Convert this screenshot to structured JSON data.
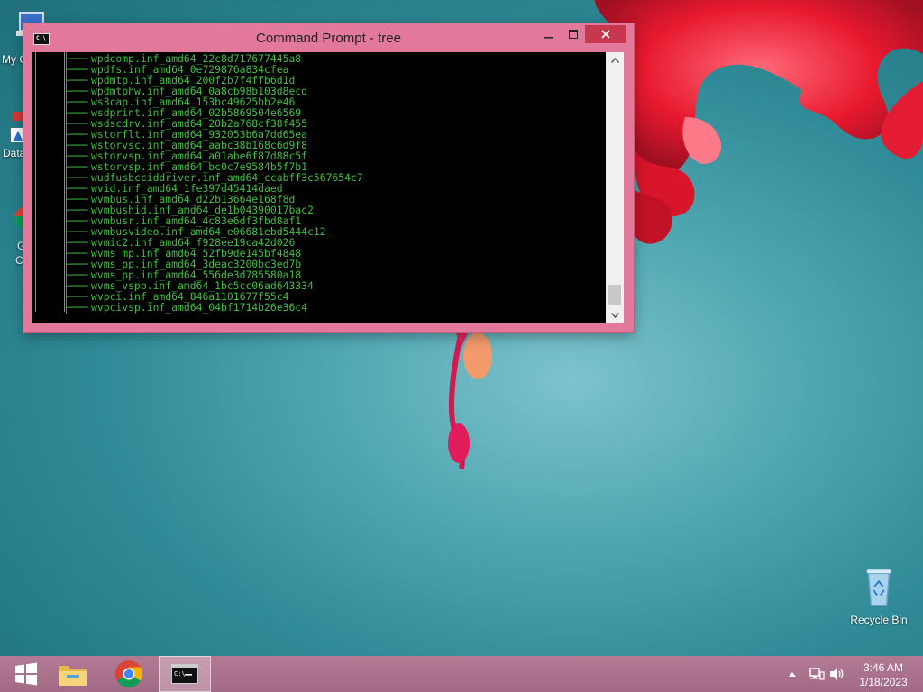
{
  "window": {
    "title": "Command Prompt - tree",
    "console_lines": [
      "wpdcomp.inf_amd64_22c8d717677445a8",
      "wpdfs.inf_amd64_0e729876a834cfea",
      "wpdmtp.inf_amd64_200f2b7f4ffb6d1d",
      "wpdmtphw.inf_amd64_0a8cb98b103d8ecd",
      "ws3cap.inf_amd64_153bc49625bb2e46",
      "wsdprint.inf_amd64_02b5869504e6569",
      "wsdscdrv.inf_amd64_20b2a768cf38f455",
      "wstorflt.inf_amd64_932053b6a7dd65ea",
      "wstorvsc.inf_amd64_aabc38b168c6d9f8",
      "wstorvsp.inf_amd64_a01abe6f87d88c5f",
      "wstorvsp.inf_amd64_bc0c7e9584b5f7b1",
      "wudfusbcciddriver.inf_amd64_ccabff3c567654c7",
      "wvid.inf_amd64_1fe397d45414daed",
      "wvmbus.inf_amd64_d22b13664e168f8d",
      "wvmbushid.inf_amd64_de1b04390017bac2",
      "wvmbusr.inf_amd64_4c83e6df3fbd8af1",
      "wvmbusvideo.inf_amd64_e06681ebd5444c12",
      "wvmic2.inf_amd64_f928ee19ca42d026",
      "wvms_mp.inf_amd64_52fb9de145bf4848",
      "wvms_pp.inf_amd64_3deac3200bc3ed7b",
      "wvms_pp.inf_amd64_556de3d785580a18",
      "wvms_vspp.inf_amd64_1bc5cc06ad643334",
      "wvpci.inf_amd64_846a1101677f55c4",
      "wvpcivsp.inf_amd64_04bf1714b26e36c4"
    ],
    "branch_prefix": "├───"
  },
  "desktop": {
    "icon_labels": {
      "my_computer": "My C",
      "data": "Data",
      "chrome_line1": "G",
      "chrome_line2": "C",
      "recycle_bin": "Recycle Bin"
    }
  },
  "taskbar": {
    "time": "3:46 AM",
    "date": "1/18/2023"
  },
  "icons": [
    "start-icon",
    "file-explorer-icon",
    "chrome-icon",
    "command-prompt-icon",
    "tray-arrow-icon",
    "network-icon",
    "volume-icon",
    "recycle-bin-icon"
  ],
  "colors": {
    "console_text": "#3fbf3f",
    "window_frame": "#e2799a",
    "close_button": "#c7384f",
    "taskbar": "#a86f8a"
  }
}
